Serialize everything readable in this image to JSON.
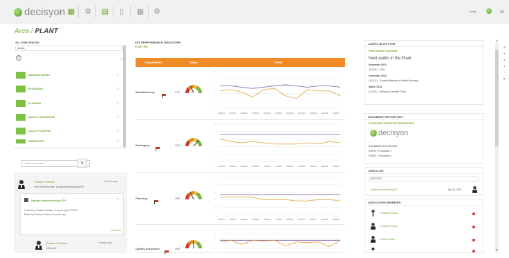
{
  "header": {
    "logo": "decisyon",
    "user": "Anna"
  },
  "page": {
    "area": "Area",
    "sep": " / ",
    "name": "PLANT"
  },
  "left": {
    "title": "All sub spaces",
    "select_value": "Areas",
    "items": [
      "MANUFACTURING",
      "PACKAGING",
      "PLANNING",
      "QUALITY ASSURANCE",
      "QUALITY CONTROL",
      "WAREHOUSE"
    ],
    "post_placeholder": "Create a new post",
    "feed": [
      {
        "name": "Posthan Posthan",
        "time": "3 weeks ago",
        "text": "Has edited the task: Update Manufacturing KPI"
      },
      {
        "name": "Posthan Posthan",
        "time": "3 weeks ago",
        "text": "100 on it"
      }
    ],
    "inner_title": "Update Manufacturing KPI",
    "inner_lines": [
      "Created by Posthan Posthan, 3 weeks ago in PLANT",
      "Edited by Posthan Posthan, 3 weeks ago"
    ],
    "inner_link": "Comment"
  },
  "kpi": {
    "title": "KEY PERFORMANCE INDICATORS",
    "sub": "PLANT KPI",
    "headers": [
      "Department",
      "Value",
      "Trend"
    ],
    "rows": [
      {
        "label": "Manufacturing",
        "pct": "37%",
        "ticks": [
          "02/2012",
          "03/2012",
          "04/2012",
          "05/2012",
          "06/2012",
          "07/2012",
          "08/2012",
          "09/2012",
          "10/2012",
          "11/2012",
          "12/2012"
        ]
      },
      {
        "label": "Packaging",
        "pct": "72%",
        "ticks": [
          "02/2012",
          "03/2012",
          "04/2012",
          "05/2012",
          "06/2012",
          "07/2012",
          "08/2012",
          "09/2012",
          "10/2012",
          "11/2012",
          "12/2012"
        ]
      },
      {
        "label": "Planning",
        "pct": "36%",
        "ticks": [
          "02/2012",
          "03/2012",
          "04/2012",
          "05/2012",
          "06/2012",
          "07/2012",
          "08/2012",
          "09/2012",
          "10/2012",
          "11/2012",
          "12/2012"
        ]
      },
      {
        "label": "Quality Assurance",
        "pct": "49%",
        "ticks": []
      }
    ]
  },
  "right": {
    "blog_title": "Latest blog post",
    "blog_sub": "Plant Audits Calendar",
    "blog_heading": "Next audits in the Plant",
    "blog_lines": [
      "November 2013",
      "18.20/11 - FDA",
      "December 2013",
      "10-11/12 - Federal Ministry of Health Germany",
      "March 2014",
      "11-13/12 - Ministry of Health China"
    ],
    "doc_title": "DOCUMENT REPOSITORY",
    "doc_sub": "STANDARD OPERATIVE PROCEDURES",
    "doc_logo": "decisyon",
    "doc_lines": [
      "DOCUMENTS ATTACHED",
      "SOP01 - Procedure 1",
      "SOP02 - Procedure 2"
    ],
    "tasks_title": "Tasks list",
    "tasks_date": "06/12/2011",
    "task_item": "Update Manufacturing KPI",
    "task_due": "Dec 31, 2011",
    "members_title": "Associated members",
    "members": [
      "Posthan Posthan",
      "Posthan Posthan",
      "Unlimit Unlimit"
    ]
  },
  "colors": {
    "accent": "#7cb342",
    "orange": "#f08a26",
    "line_purple": "#7a5aa8",
    "line_orange": "#e0a23a"
  }
}
